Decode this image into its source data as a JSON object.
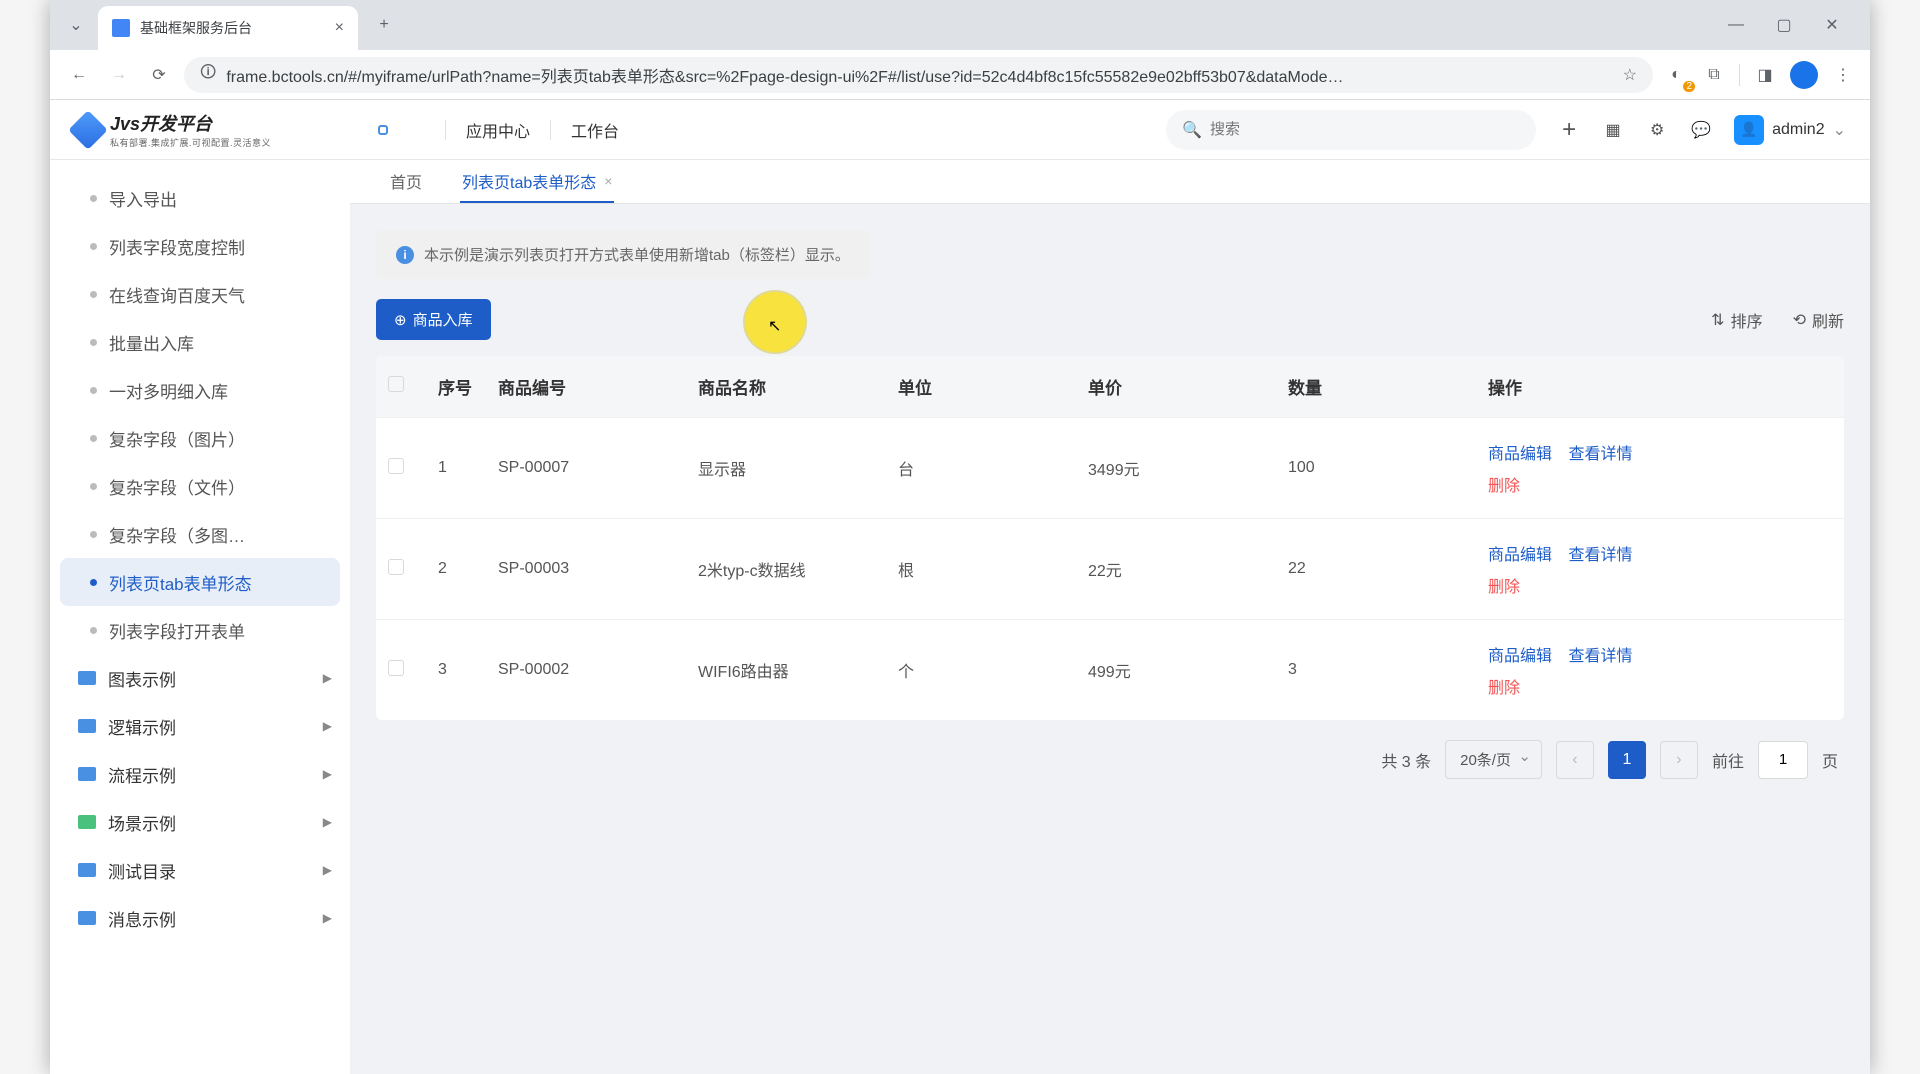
{
  "browserTab": {
    "title": "基础框架服务后台"
  },
  "url": "frame.bctools.cn/#/myiframe/urlPath?name=列表页tab表单形态&src=%2Fpage-design-ui%2F#/list/use?id=52c4d4bf8c15fc55582e9e02bff53b07&dataMode…",
  "logo": {
    "title": "Jvs开发平台",
    "subtitle": "私有部署.集成扩展.可视配置.灵活意义"
  },
  "headerNav": {
    "appCenter": "应用中心",
    "workbench": "工作台"
  },
  "search": {
    "placeholder": "搜索"
  },
  "user": {
    "name": "admin2"
  },
  "sidebar": {
    "items": [
      "导入导出",
      "列表字段宽度控制",
      "在线查询百度天气",
      "批量出入库",
      "一对多明细入库",
      "复杂字段（图片）",
      "复杂字段（文件）",
      "复杂字段（多图…",
      "列表页tab表单形态",
      "列表字段打开表单"
    ],
    "groups": [
      {
        "label": "图表示例",
        "color": "#4a90e2"
      },
      {
        "label": "逻辑示例",
        "color": "#4a90e2"
      },
      {
        "label": "流程示例",
        "color": "#4a90e2"
      },
      {
        "label": "场景示例",
        "color": "#4ac27d"
      },
      {
        "label": "测试目录",
        "color": "#4a90e2"
      },
      {
        "label": "消息示例",
        "color": "#4a90e2"
      }
    ]
  },
  "pageTabs": {
    "home": "首页",
    "current": "列表页tab表单形态"
  },
  "alert": "本示例是演示列表页打开方式表单使用新增tab（标签栏）显示。",
  "buttons": {
    "addStock": "商品入库",
    "sort": "排序",
    "refresh": "刷新"
  },
  "table": {
    "headers": [
      "序号",
      "商品编号",
      "商品名称",
      "单位",
      "单价",
      "数量",
      "操作"
    ],
    "rows": [
      {
        "idx": "1",
        "code": "SP-00007",
        "name": "显示器",
        "unit": "台",
        "price": "3499元",
        "qty": "100"
      },
      {
        "idx": "2",
        "code": "SP-00003",
        "name": "2米typ-c数据线",
        "unit": "根",
        "price": "22元",
        "qty": "22"
      },
      {
        "idx": "3",
        "code": "SP-00002",
        "name": "WIFI6路由器",
        "unit": "个",
        "price": "499元",
        "qty": "3"
      }
    ],
    "actions": {
      "edit": "商品编辑",
      "view": "查看详情",
      "delete": "删除"
    }
  },
  "pagination": {
    "total": "共 3 条",
    "pageSize": "20条/页",
    "current": "1",
    "goto": "前往",
    "page": "页"
  }
}
